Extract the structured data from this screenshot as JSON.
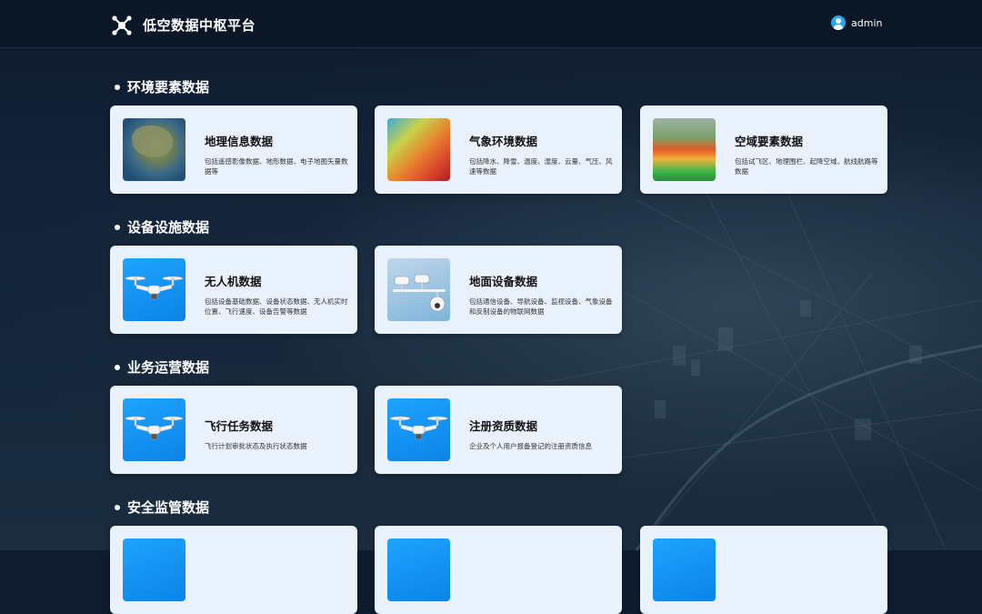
{
  "header": {
    "title": "低空数据中枢平台",
    "username": "admin"
  },
  "sections": [
    {
      "title": "环境要素数据",
      "cards": [
        {
          "name": "地理信息数据",
          "desc": "包括遥感影像数据、地形数据、电子地图矢量数据等",
          "icon": "satellite-map-image"
        },
        {
          "name": "气象环境数据",
          "desc": "包括降水、降雪、温度、湿度、云量、气压、风速等数据",
          "icon": "weather-heatmap-image"
        },
        {
          "name": "空域要素数据",
          "desc": "包括试飞区、地理围栏、起降空域、航线航路等数据",
          "icon": "airspace-map-image"
        }
      ]
    },
    {
      "title": "设备设施数据",
      "cards": [
        {
          "name": "无人机数据",
          "desc": "包括设备基础数据、设备状态数据、无人机实时位置、飞行速度、设备告警等数据",
          "icon": "drone-image"
        },
        {
          "name": "地面设备数据",
          "desc": "包括通信设备、导航设备、监视设备、气象设备和反制设备的物联网数据",
          "icon": "camera-image"
        }
      ]
    },
    {
      "title": "业务运营数据",
      "cards": [
        {
          "name": "飞行任务数据",
          "desc": "飞行计划审批状态及执行状态数据",
          "icon": "drone-image"
        },
        {
          "name": "注册资质数据",
          "desc": "企业及个人用户报备登记的注册资质信息",
          "icon": "drone-image"
        }
      ]
    },
    {
      "title": "安全监管数据",
      "cards": [
        {
          "name": "",
          "desc": "",
          "icon": "drone-image"
        },
        {
          "name": "",
          "desc": "",
          "icon": "drone-image"
        },
        {
          "name": "",
          "desc": "",
          "icon": "drone-image"
        }
      ]
    }
  ],
  "colors": {
    "header_bg": "#0b1626",
    "card_bg": "#e9f1fc",
    "accent": "#2aa7f0"
  }
}
